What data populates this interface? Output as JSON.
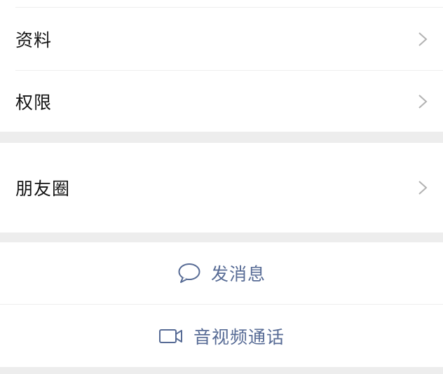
{
  "contact_menu": {
    "items": [
      {
        "label": "资料"
      },
      {
        "label": "权限"
      },
      {
        "label": "朋友圈"
      }
    ]
  },
  "actions": {
    "send_message": "发消息",
    "video_call": "音视频通话"
  },
  "colors": {
    "background": "#ededed",
    "card": "#ffffff",
    "text": "#141414",
    "action_text": "#576b95",
    "chevron": "#b2b2b2"
  },
  "icons": {
    "chevron": "chevron-right-icon",
    "message": "chat-bubble-icon",
    "video": "video-camera-icon"
  }
}
